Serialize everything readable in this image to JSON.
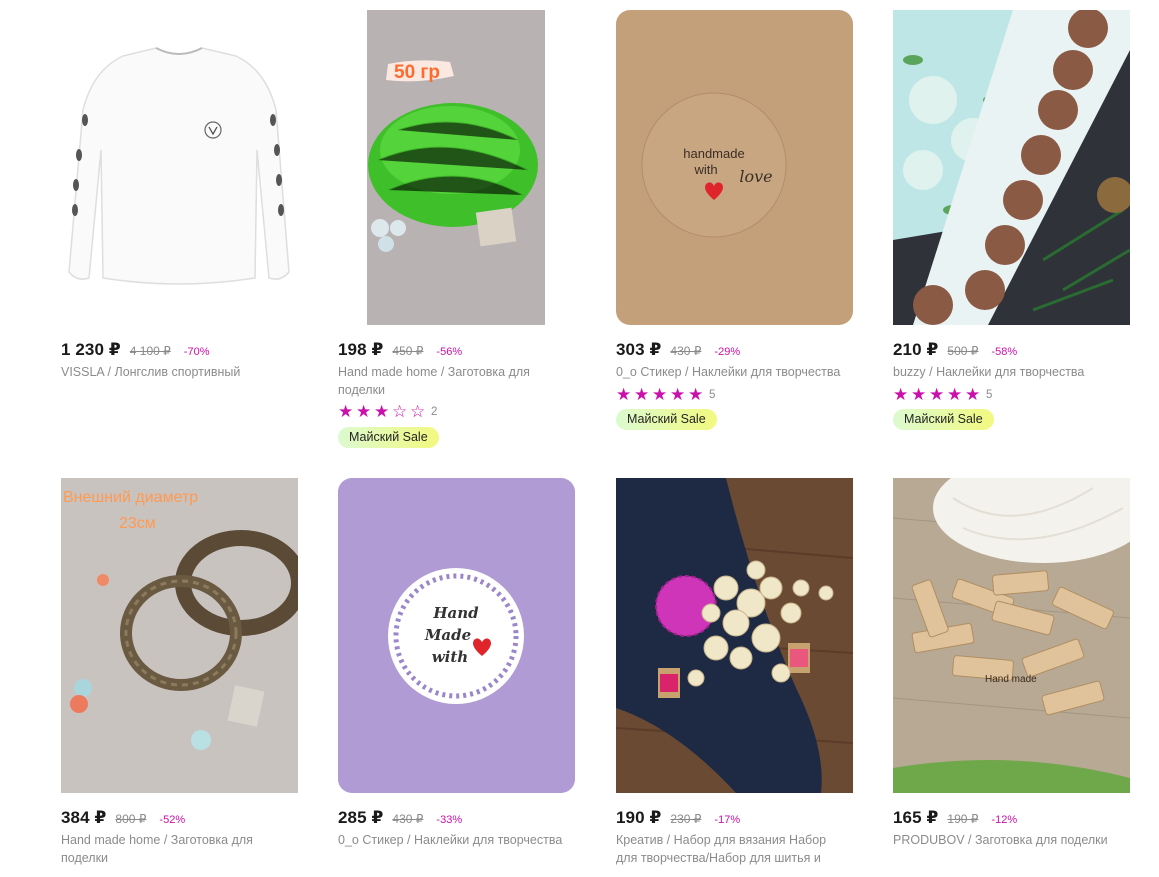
{
  "products": [
    {
      "price": "1 230 ₽",
      "old_price": "4 100 ₽",
      "discount": "-70%",
      "title": "VISSLA / Лонгслив спортивный",
      "rating_count": "",
      "badge": ""
    },
    {
      "price": "198 ₽",
      "old_price": "450 ₽",
      "discount": "-56%",
      "title": "Hand made home / Заготовка для поделки",
      "rating_count": "2",
      "stars": 3,
      "badge": "Майский Sale",
      "image_text": "50 гр"
    },
    {
      "price": "303 ₽",
      "old_price": "430 ₽",
      "discount": "-29%",
      "title": "0_о Стикер / Наклейки для творчества",
      "rating_count": "5",
      "stars": 5,
      "badge": "Майский Sale",
      "image_text_1": "handmade",
      "image_text_2": "with",
      "image_text_3": "love"
    },
    {
      "price": "210 ₽",
      "old_price": "500 ₽",
      "discount": "-58%",
      "title": "buzzy / Наклейки для творчества",
      "rating_count": "5",
      "stars": 5,
      "badge": "Майский Sale"
    },
    {
      "price": "384 ₽",
      "old_price": "800 ₽",
      "discount": "-52%",
      "title": "Hand made home / Заготовка для поделки",
      "image_text_1": "Внешний диаметр",
      "image_text_2": "23см"
    },
    {
      "price": "285 ₽",
      "old_price": "430 ₽",
      "discount": "-33%",
      "title": "0_о Стикер / Наклейки для творчества",
      "image_text_1": "Hand",
      "image_text_2": "Made",
      "image_text_3": "with"
    },
    {
      "price": "190 ₽",
      "old_price": "230 ₽",
      "discount": "-17%",
      "title": "Креатив / Набор для вязания Набор для творчества/Набор для шитья и"
    },
    {
      "price": "165 ₽",
      "old_price": "190 ₽",
      "discount": "-12%",
      "title": "PRODUBOV / Заготовка для поделки",
      "image_text_1": "Hand made"
    }
  ],
  "icons": {
    "star_filled": "★",
    "star_empty": "☆"
  },
  "colors": {
    "accent": "#cb11ab",
    "badge_from": "#dcfad0",
    "badge_to": "#f2f97f"
  }
}
